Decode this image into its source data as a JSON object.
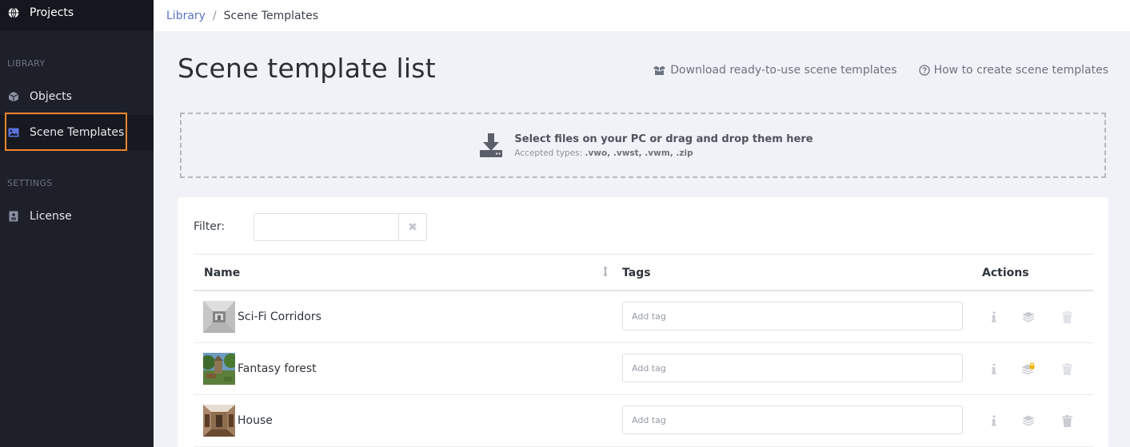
{
  "sidebar": {
    "projects_label": "Projects",
    "library_section": "LIBRARY",
    "settings_section": "SETTINGS",
    "items": [
      {
        "label": "Objects",
        "icon": "cube-icon"
      },
      {
        "label": "Scene Templates",
        "icon": "image-icon",
        "active": true
      },
      {
        "label": "License",
        "icon": "id-card-icon"
      }
    ]
  },
  "breadcrumb": {
    "link": "Library",
    "separator": "/",
    "current": "Scene Templates"
  },
  "page": {
    "title": "Scene template list",
    "download_link": "Download ready-to-use scene templates",
    "howto_link": "How to create scene templates"
  },
  "dropzone": {
    "title": "Select files on your PC or drag and drop them here",
    "accepted_prefix": "Accepted types: ",
    "accepted_types": ".vwo, .vwst, .vwm, .zip"
  },
  "filter": {
    "label": "Filter:",
    "value": "",
    "clear_symbol": "✖"
  },
  "table": {
    "headers": {
      "name": "Name",
      "tags": "Tags",
      "actions": "Actions"
    },
    "rows": [
      {
        "name": "Sci-Fi Corridors",
        "tag_placeholder": "Add tag",
        "locked": false
      },
      {
        "name": "Fantasy forest",
        "tag_placeholder": "Add tag",
        "locked": true
      },
      {
        "name": "House",
        "tag_placeholder": "Add tag",
        "locked": false
      }
    ]
  },
  "colors": {
    "sidebar_bg": "#1e2029",
    "accent": "#5b73c5",
    "active_outline": "#f0852b",
    "lock": "#f5b400"
  }
}
